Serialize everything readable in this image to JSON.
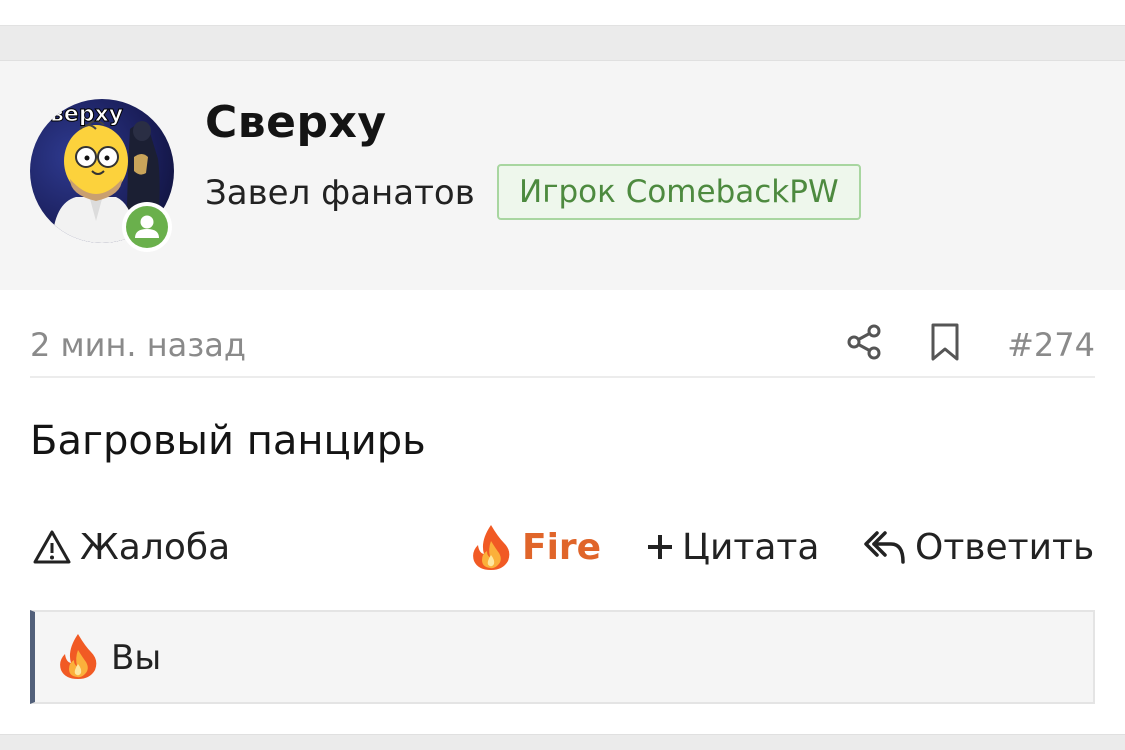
{
  "author": {
    "username": "Сверху",
    "title": "Завел фанатов",
    "badge": "Игрок ComebackPW",
    "avatar_caption": "верху",
    "online": true
  },
  "post": {
    "time": "2 мин. назад",
    "number": "#274",
    "text": "Багровый панцирь"
  },
  "actions": {
    "report": "Жалоба",
    "fire": "Fire",
    "quote": "Цитата",
    "reply": "Ответить"
  },
  "reactions": {
    "label": "Вы"
  },
  "colors": {
    "fire_accent": "#e0652a",
    "online": "#6ab04c",
    "badge_text": "#4d8a3f",
    "reactions_border": "#52607a"
  }
}
